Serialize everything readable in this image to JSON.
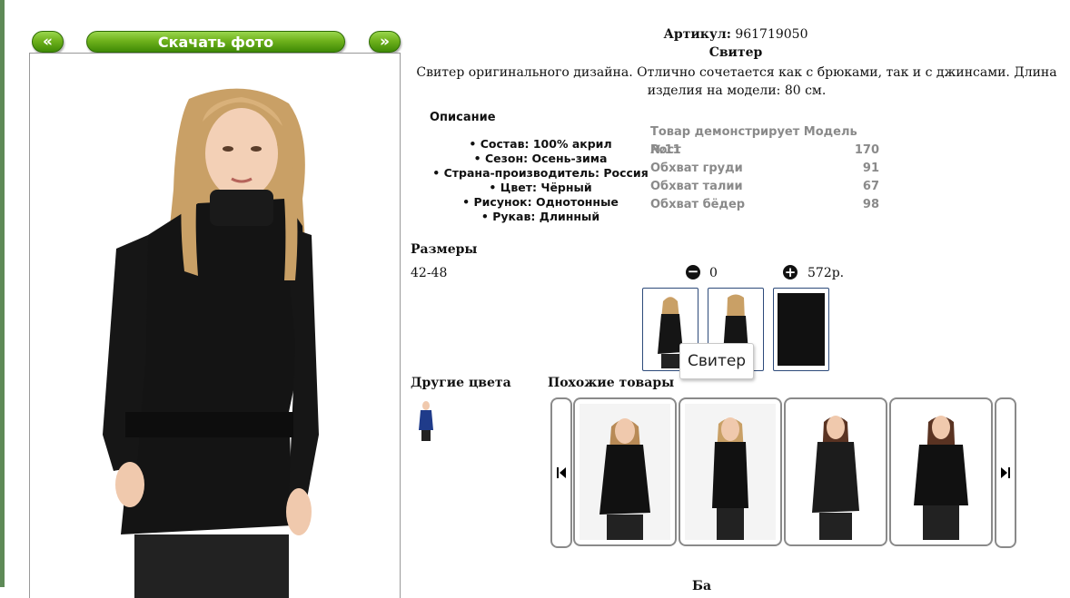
{
  "nav": {
    "prev_label": "«",
    "download_label": "Скачать фото",
    "next_label": "»"
  },
  "product": {
    "article_label": "Артикул:",
    "article_value": "961719050",
    "title": "Свитер",
    "description": "Свитер оригинального дизайна. Отлично сочетается как с брюками, так и с джинсами. Длина изделия на модели: 80 см."
  },
  "description_block": {
    "heading": "Описание",
    "items": [
      "Состав: 100% акрил",
      "Сезон: Осень-зима",
      "Страна-производитель: Россия",
      "Цвет: Чёрный",
      "Рисунок: Однотонные",
      "Рукав: Длинный"
    ]
  },
  "model": {
    "title": "Товар демонстрирует Модель №11",
    "rows": [
      {
        "label": "Рост",
        "value": "170"
      },
      {
        "label": "Обхват груди",
        "value": "91"
      },
      {
        "label": "Обхват талии",
        "value": "67"
      },
      {
        "label": "Обхват бёдер",
        "value": "98"
      }
    ]
  },
  "sizes": {
    "heading": "Размеры",
    "value": "42-48",
    "quantity": "0",
    "price": "572р."
  },
  "tooltip": "Свитер",
  "other_colors": {
    "heading": "Другие цвета"
  },
  "similar": {
    "heading": "Похожие товары"
  },
  "bottom_partial": "Ба",
  "colors": {
    "green": "#6fb21c",
    "thumb_border": "#2d4a7a",
    "gray": "#8a8a8a"
  }
}
